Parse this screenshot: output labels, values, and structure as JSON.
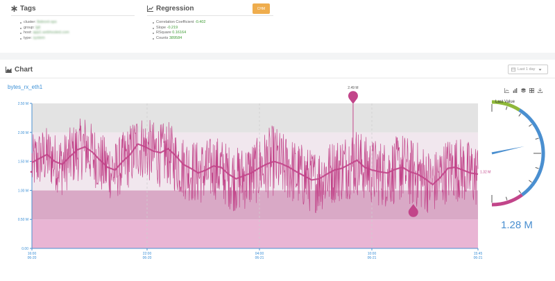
{
  "tags": {
    "title": "Tags",
    "items": [
      {
        "label": "cluster:",
        "value": "lbdeonl-ops"
      },
      {
        "label": "group:",
        "value": "lgit"
      },
      {
        "label": "host:",
        "value": "app1.webhosted.com"
      },
      {
        "label": "type:",
        "value": "system"
      }
    ]
  },
  "regression": {
    "title": "Regression",
    "button_label": "CHM",
    "items": [
      {
        "label": "Correlation Coefficient",
        "value": "-0.402"
      },
      {
        "label": "Slope",
        "value": "-0.219"
      },
      {
        "label": "RSquare",
        "value": "0.16164"
      },
      {
        "label": "Counts",
        "value": "389584"
      }
    ]
  },
  "chart_section": {
    "title": "Chart",
    "range_label": "Last 1 day"
  },
  "metric_name": "bytes_rx_eth1",
  "gauge": {
    "title": "Last Value",
    "value_label": "1.28 M",
    "fraction": 0.51
  },
  "colors": {
    "series": "#c2458a",
    "accent": "#3a8fd6",
    "button": "#efad4d",
    "gauge_green": "#8fb83a",
    "gauge_blue": "#4a8fd0",
    "gauge_pink": "#c2458a"
  },
  "chart_data": {
    "type": "line",
    "title": "bytes_rx_eth1",
    "xlabel": "",
    "ylabel": "",
    "ylim": [
      0,
      2500000
    ],
    "yticks": [
      "0.00",
      "0.50 M",
      "1.00 M",
      "1.50 M",
      "2.00 M",
      "2.50 M"
    ],
    "xticks": [
      {
        "time": "16:00",
        "date": "06-20"
      },
      {
        "time": "22:00",
        "date": "06-20"
      },
      {
        "time": "04:00",
        "date": "06-21"
      },
      {
        "time": "10:00",
        "date": "06-21"
      },
      {
        "time": "15:45",
        "date": "06-21"
      }
    ],
    "bands": [
      {
        "from": 0,
        "to": 500000,
        "color": "#e9b5d4"
      },
      {
        "from": 500000,
        "to": 1000000,
        "color": "#d9a9c6"
      },
      {
        "from": 1000000,
        "to": 2000000,
        "color": "#f1e7ee"
      },
      {
        "from": 2000000,
        "to": 2500000,
        "color": "#e3e3e3"
      }
    ],
    "series": [
      {
        "values": [
          1.48,
          1.55,
          1.62,
          1.5,
          1.45,
          1.58,
          1.7,
          1.75,
          1.66,
          1.52,
          1.4,
          1.35,
          1.5,
          1.62,
          1.8,
          1.75,
          1.68,
          1.65,
          1.72,
          1.6,
          1.45,
          1.38,
          1.3,
          1.35,
          1.42,
          1.4,
          1.28,
          1.2,
          1.25,
          1.3,
          1.38,
          1.45,
          1.5,
          1.46,
          1.4,
          1.32,
          1.25,
          1.18,
          1.2,
          1.28,
          1.35,
          1.38,
          1.45,
          1.52,
          1.4,
          1.35,
          1.32,
          1.3,
          1.36,
          1.4,
          1.32,
          1.28,
          1.2,
          1.1,
          1.22,
          1.38,
          1.4,
          1.35,
          1.3,
          1.28
        ],
        "band_low": [
          0.95,
          1.05,
          1.1,
          1.0,
          0.9,
          1.05,
          1.15,
          1.2,
          1.1,
          0.95,
          0.85,
          0.82,
          0.95,
          1.05,
          1.2,
          1.18,
          1.1,
          1.05,
          1.1,
          0.95,
          0.85,
          0.8,
          0.75,
          0.78,
          0.85,
          0.8,
          0.68,
          0.62,
          0.65,
          0.7,
          0.8,
          0.85,
          0.9,
          0.86,
          0.8,
          0.72,
          0.68,
          0.6,
          0.62,
          0.7,
          0.78,
          0.8,
          0.85,
          0.9,
          0.82,
          0.75,
          0.72,
          0.7,
          0.76,
          0.8,
          0.72,
          0.68,
          0.62,
          0.58,
          0.68,
          0.8,
          0.82,
          0.78,
          0.72,
          0.7
        ],
        "band_high": [
          1.95,
          2.05,
          2.1,
          2.0,
          1.95,
          2.08,
          2.2,
          2.3,
          2.15,
          2.0,
          1.9,
          1.85,
          2.0,
          2.15,
          2.35,
          2.25,
          2.2,
          2.15,
          2.2,
          2.05,
          1.95,
          1.9,
          1.85,
          1.88,
          1.95,
          1.92,
          1.8,
          1.75,
          1.78,
          1.85,
          1.92,
          2.05,
          2.15,
          2.0,
          1.95,
          1.85,
          1.8,
          1.7,
          1.75,
          1.82,
          1.9,
          1.95,
          2.05,
          2.1,
          1.95,
          1.9,
          1.88,
          1.85,
          1.92,
          2.0,
          1.9,
          1.85,
          1.78,
          1.65,
          1.78,
          1.92,
          1.95,
          1.9,
          1.85,
          1.82
        ]
      }
    ],
    "max_marker": {
      "label": "2.49 M",
      "value": 2.49,
      "position": 0.72
    },
    "min_marker": {
      "value": 0.62,
      "position": 0.855
    },
    "last_value_label": "1.32 M"
  }
}
